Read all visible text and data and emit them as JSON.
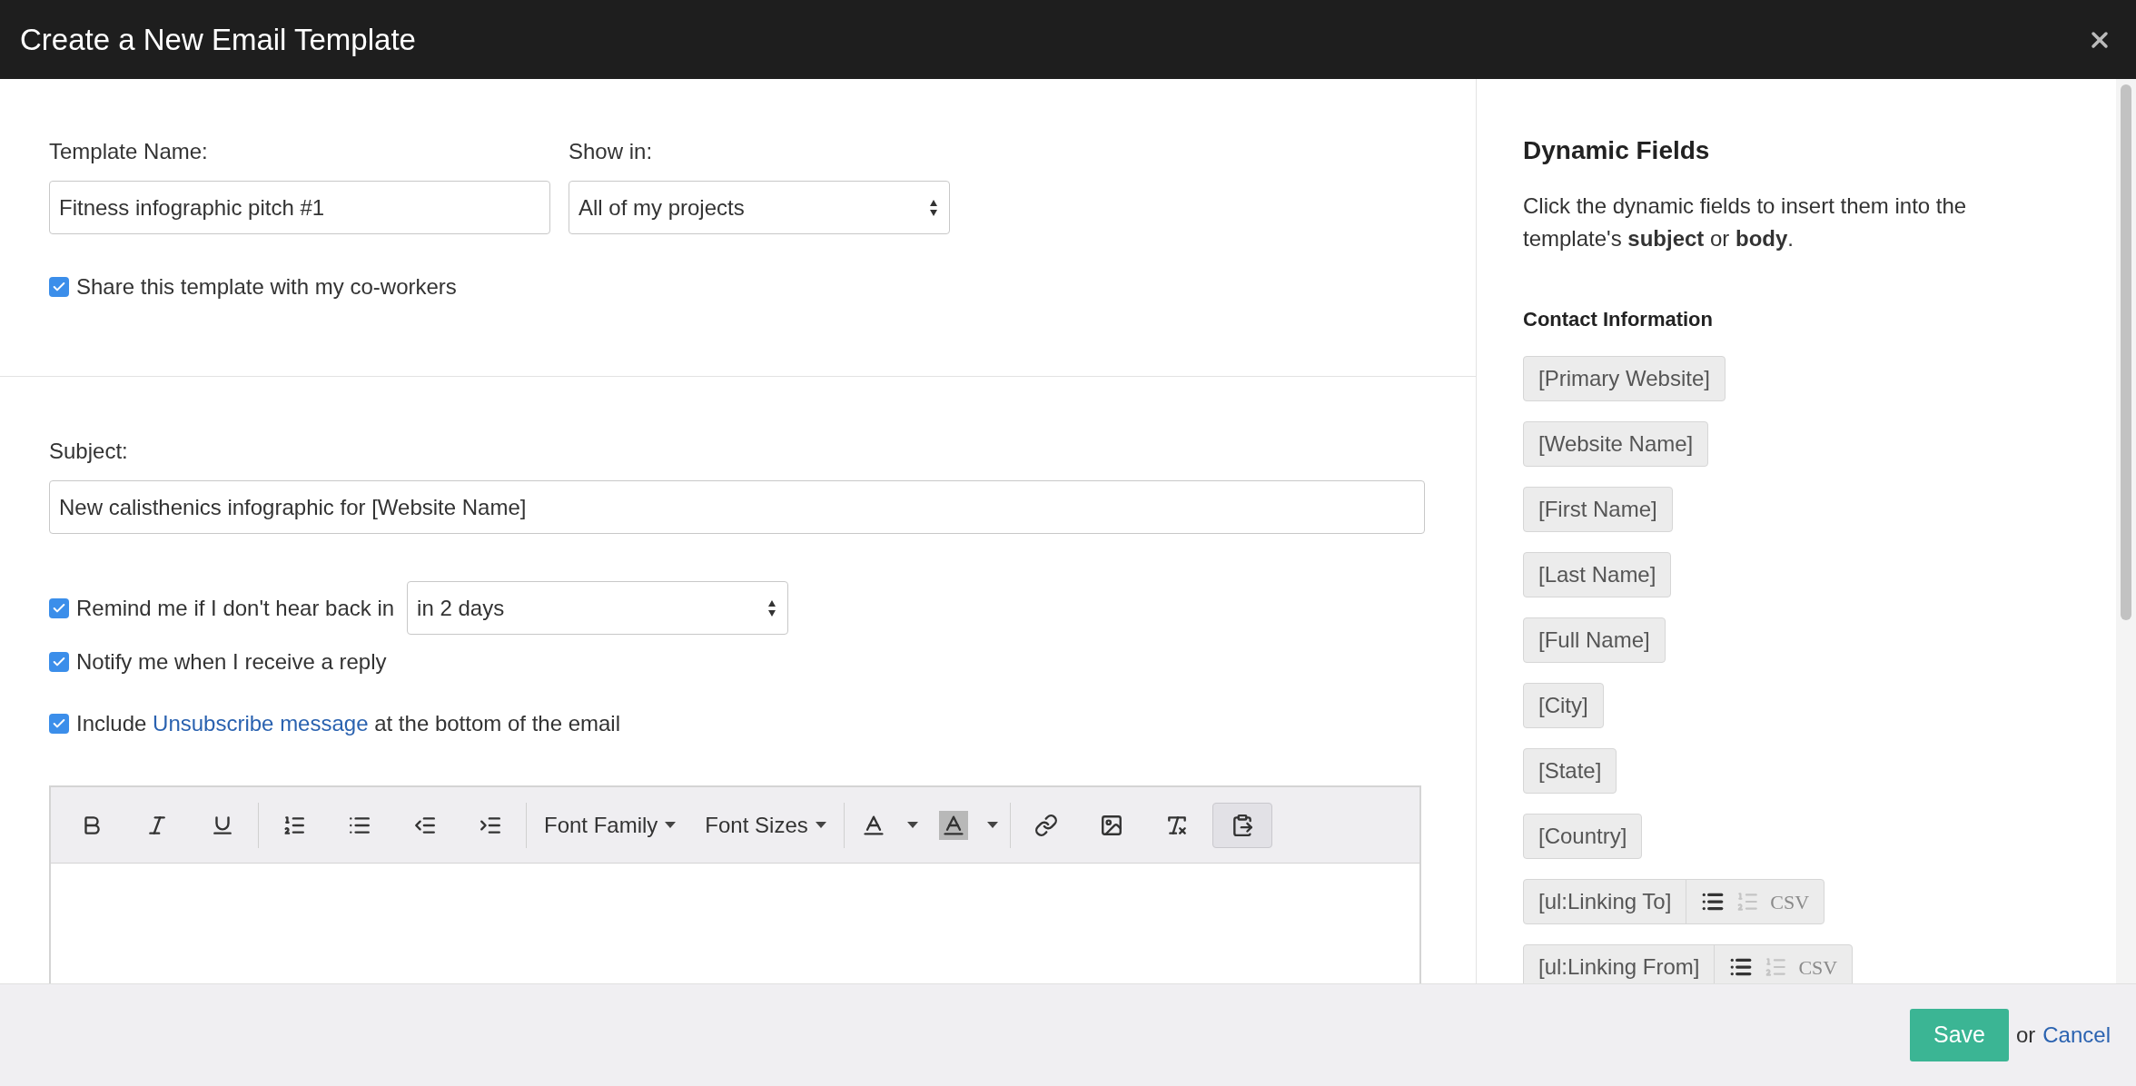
{
  "window": {
    "title": "Create a New Email Template"
  },
  "template_name": {
    "label": "Template Name:",
    "value": "Fitness infographic pitch #1"
  },
  "show_in": {
    "label": "Show in:",
    "value": "All of my projects"
  },
  "share": {
    "label": "Share this template with my co-workers",
    "checked": true
  },
  "subject": {
    "label": "Subject:",
    "value": "New calisthenics infographic for [Website Name]"
  },
  "remind": {
    "label": "Remind me if I don't hear back in",
    "checked": true,
    "value": "in 2 days"
  },
  "notify": {
    "label": "Notify me when I receive a reply",
    "checked": true
  },
  "unsubscribe": {
    "before": "Include",
    "link": "Unsubscribe message",
    "after": "at the bottom of the email",
    "checked": true
  },
  "toolbar": [
    [
      {
        "kind": "bold",
        "selected": false
      },
      {
        "kind": "italic",
        "selected": false
      },
      {
        "kind": "underline",
        "selected": false
      }
    ],
    [
      {
        "kind": "ordered-list",
        "selected": false
      },
      {
        "kind": "bullet-list",
        "selected": false
      },
      {
        "kind": "outdent",
        "selected": false
      },
      {
        "kind": "indent",
        "selected": false
      }
    ],
    [
      {
        "kind": "dropdown",
        "label": "Font Family",
        "selected": false
      },
      {
        "kind": "dropdown",
        "label": "Font Sizes",
        "selected": false
      }
    ],
    [
      {
        "kind": "text-color",
        "selected": false
      },
      {
        "kind": "background-color",
        "selected": false
      }
    ],
    [
      {
        "kind": "link",
        "selected": false
      },
      {
        "kind": "image",
        "selected": false
      },
      {
        "kind": "clear-format",
        "selected": false
      },
      {
        "kind": "paste",
        "selected": true
      }
    ]
  ],
  "dynamic_fields": {
    "title": "Dynamic Fields",
    "description": "Click the dynamic fields to insert them into the template's **subject** or **body**.",
    "section": "Contact Information",
    "fields": [
      {
        "label": "[Primary Website]",
        "kind": "plain"
      },
      {
        "label": "[Website Name]",
        "kind": "plain"
      },
      {
        "label": "[First Name]",
        "kind": "plain"
      },
      {
        "label": "[Last Name]",
        "kind": "plain"
      },
      {
        "label": "[Full Name]",
        "kind": "plain"
      },
      {
        "label": "[City]",
        "kind": "plain"
      },
      {
        "label": "[State]",
        "kind": "plain"
      },
      {
        "label": "[Country]",
        "kind": "plain"
      },
      {
        "label": "[ul:Linking To]",
        "kind": "list",
        "options": [
          {
            "kind": "bullets",
            "selected": true
          },
          {
            "kind": "numbers",
            "selected": false
          },
          {
            "kind": "csv",
            "label": "CSV",
            "selected": false
          }
        ]
      },
      {
        "label": "[ul:Linking From]",
        "kind": "list",
        "options": [
          {
            "kind": "bullets",
            "selected": true
          },
          {
            "kind": "numbers",
            "selected": false
          },
          {
            "kind": "csv",
            "label": "CSV",
            "selected": false
          }
        ]
      }
    ]
  },
  "footer": {
    "save": "Save",
    "or": "or",
    "cancel": "Cancel"
  }
}
